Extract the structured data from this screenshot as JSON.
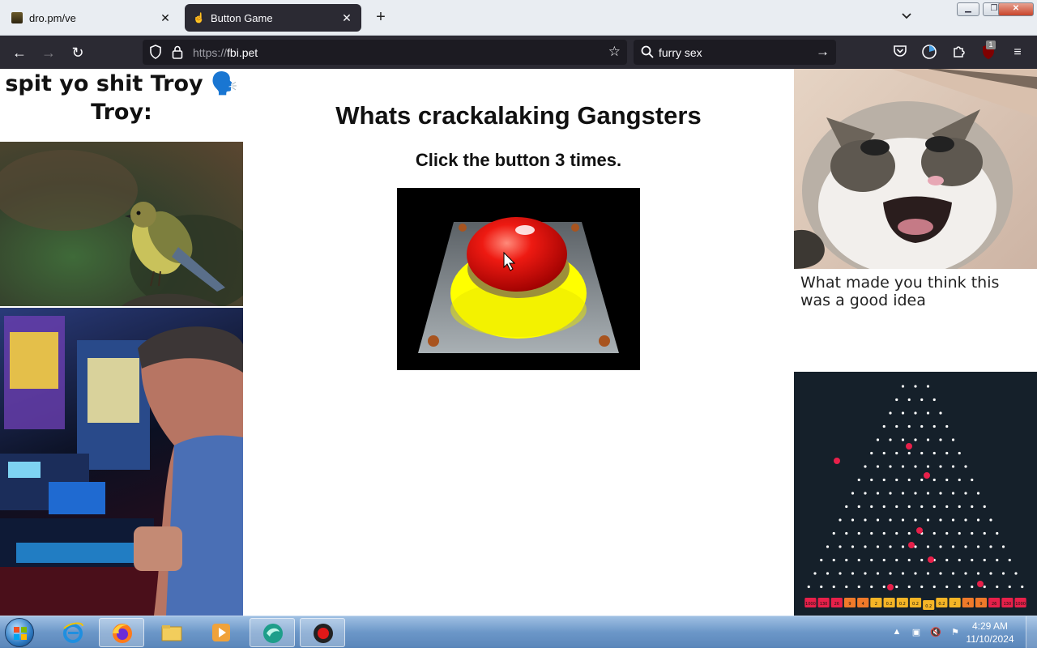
{
  "browser": {
    "tabs": [
      {
        "title": "dro.pm/ve",
        "active": false
      },
      {
        "title": "Button Game",
        "active": true
      }
    ],
    "new_tab": "+",
    "url_scheme": "https://",
    "url_host": "fbi.pet",
    "search_query": "furry sex",
    "extension_badge": "1"
  },
  "page": {
    "meme_line1": "spit yo shit Troy 🗣️",
    "meme_line2": "Troy:",
    "heading": "Whats crackalaking Gangsters",
    "instruction": "Click the button 3 times.",
    "cat_caption": "What made you think this was a good idea"
  },
  "plinko": {
    "rows": 16,
    "multipliers": [
      "1000",
      "130",
      "26",
      "9",
      "4",
      "2",
      "0.2",
      "0.2",
      "0.2",
      "0.2",
      "0.2",
      "2",
      "4",
      "9",
      "26",
      "130",
      "1000"
    ],
    "colors": {
      "ball": "#e8204a",
      "peg": "#ffffff",
      "bg": "#15202a",
      "slot": "#e8204a",
      "slot_mid": "#f5b526"
    }
  },
  "taskbar": {
    "time": "4:29 AM",
    "date": "11/10/2024"
  }
}
